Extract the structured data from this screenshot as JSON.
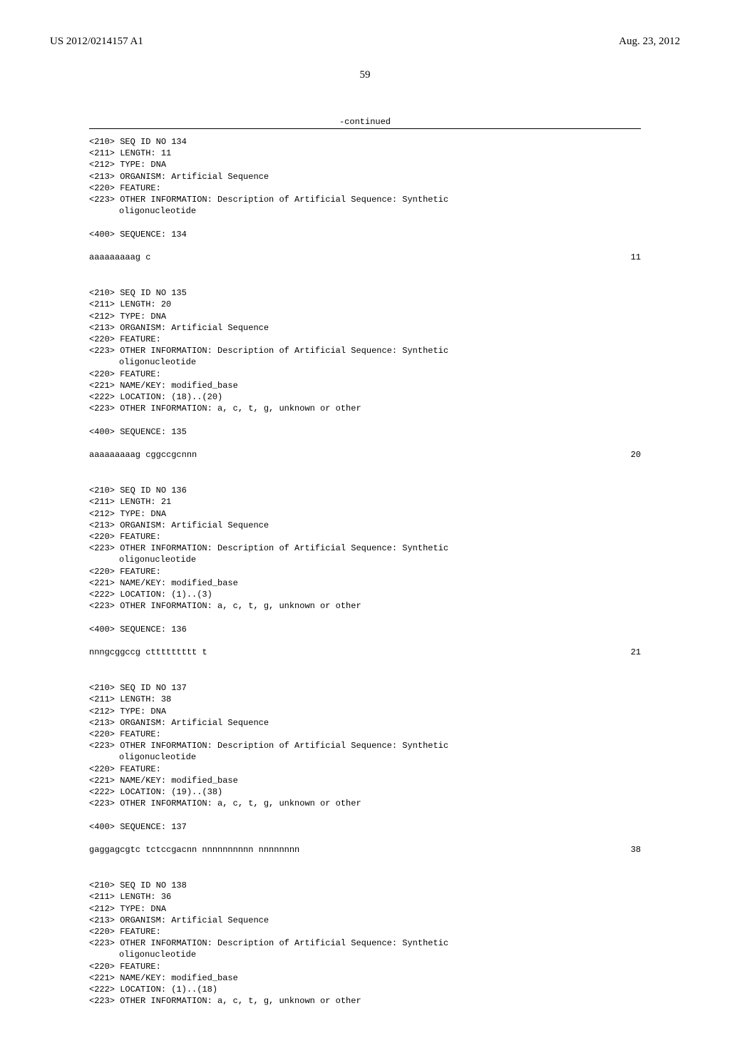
{
  "header": {
    "pub_number": "US 2012/0214157 A1",
    "pub_date": "Aug. 23, 2012"
  },
  "page_number": "59",
  "continued_label": "-continued",
  "sequences": [
    {
      "meta": [
        "<210> SEQ ID NO 134",
        "<211> LENGTH: 11",
        "<212> TYPE: DNA",
        "<213> ORGANISM: Artificial Sequence",
        "<220> FEATURE:",
        "<223> OTHER INFORMATION: Description of Artificial Sequence: Synthetic"
      ],
      "meta_indent": [
        "oligonucleotide"
      ],
      "seq_header": "<400> SEQUENCE: 134",
      "seq_line": "aaaaaaaaag c",
      "seq_len": "11"
    },
    {
      "meta": [
        "<210> SEQ ID NO 135",
        "<211> LENGTH: 20",
        "<212> TYPE: DNA",
        "<213> ORGANISM: Artificial Sequence",
        "<220> FEATURE:",
        "<223> OTHER INFORMATION: Description of Artificial Sequence: Synthetic"
      ],
      "meta_indent": [
        "oligonucleotide"
      ],
      "meta2": [
        "<220> FEATURE:",
        "<221> NAME/KEY: modified_base",
        "<222> LOCATION: (18)..(20)",
        "<223> OTHER INFORMATION: a, c, t, g, unknown or other"
      ],
      "seq_header": "<400> SEQUENCE: 135",
      "seq_line": "aaaaaaaaag cggccgcnnn",
      "seq_len": "20"
    },
    {
      "meta": [
        "<210> SEQ ID NO 136",
        "<211> LENGTH: 21",
        "<212> TYPE: DNA",
        "<213> ORGANISM: Artificial Sequence",
        "<220> FEATURE:",
        "<223> OTHER INFORMATION: Description of Artificial Sequence: Synthetic"
      ],
      "meta_indent": [
        "oligonucleotide"
      ],
      "meta2": [
        "<220> FEATURE:",
        "<221> NAME/KEY: modified_base",
        "<222> LOCATION: (1)..(3)",
        "<223> OTHER INFORMATION: a, c, t, g, unknown or other"
      ],
      "seq_header": "<400> SEQUENCE: 136",
      "seq_line": "nnngcggccg cttttttttt t",
      "seq_len": "21"
    },
    {
      "meta": [
        "<210> SEQ ID NO 137",
        "<211> LENGTH: 38",
        "<212> TYPE: DNA",
        "<213> ORGANISM: Artificial Sequence",
        "<220> FEATURE:",
        "<223> OTHER INFORMATION: Description of Artificial Sequence: Synthetic"
      ],
      "meta_indent": [
        "oligonucleotide"
      ],
      "meta2": [
        "<220> FEATURE:",
        "<221> NAME/KEY: modified_base",
        "<222> LOCATION: (19)..(38)",
        "<223> OTHER INFORMATION: a, c, t, g, unknown or other"
      ],
      "seq_header": "<400> SEQUENCE: 137",
      "seq_line": "gaggagcgtc tctccgacnn nnnnnnnnnn nnnnnnnn",
      "seq_len": "38"
    },
    {
      "meta": [
        "<210> SEQ ID NO 138",
        "<211> LENGTH: 36",
        "<212> TYPE: DNA",
        "<213> ORGANISM: Artificial Sequence",
        "<220> FEATURE:",
        "<223> OTHER INFORMATION: Description of Artificial Sequence: Synthetic"
      ],
      "meta_indent": [
        "oligonucleotide"
      ],
      "meta2": [
        "<220> FEATURE:",
        "<221> NAME/KEY: modified_base",
        "<222> LOCATION: (1)..(18)",
        "<223> OTHER INFORMATION: a, c, t, g, unknown or other"
      ],
      "seq_header": "",
      "seq_line": "",
      "seq_len": ""
    }
  ]
}
